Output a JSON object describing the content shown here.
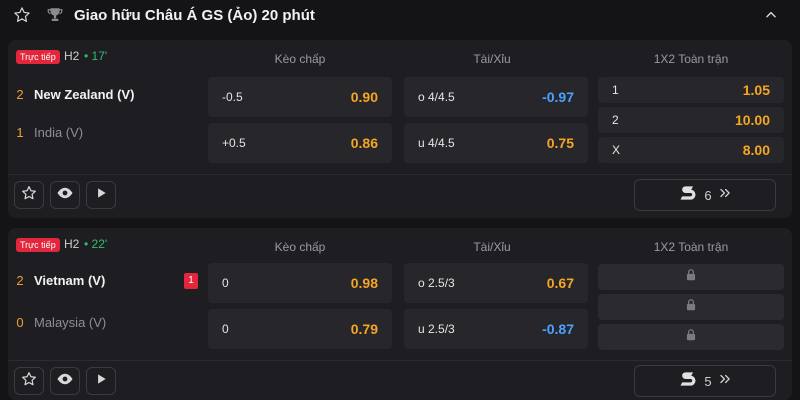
{
  "league": {
    "title": "Giao hữu Châu Á GS (Ảo) 20 phút"
  },
  "columns": {
    "handicap": "Kèo chấp",
    "over_under": "Tài/Xỉu",
    "x12": "1X2 Toàn trận"
  },
  "matches": [
    {
      "live_badge": "Trực tiếp",
      "half": "H2",
      "time": "• 17'",
      "home": {
        "score": "2",
        "name": "New Zealand (V)"
      },
      "away": {
        "score": "1",
        "name": "India (V)"
      },
      "handicap": [
        {
          "line": "-0.5",
          "odds": "0.90"
        },
        {
          "line": "+0.5",
          "odds": "0.86"
        }
      ],
      "over_under": [
        {
          "line": "o 4/4.5",
          "odds": "-0.97"
        },
        {
          "line": "u 4/4.5",
          "odds": "0.75"
        }
      ],
      "x12": [
        {
          "label": "1",
          "odds": "1.05"
        },
        {
          "label": "2",
          "odds": "10.00"
        },
        {
          "label": "X",
          "odds": "8.00"
        }
      ],
      "more_count": "6"
    },
    {
      "live_badge": "Trực tiếp",
      "half": "H2",
      "time": "• 22'",
      "home": {
        "score": "2",
        "name": "Vietnam (V)",
        "red_cards": "1"
      },
      "away": {
        "score": "0",
        "name": "Malaysia (V)"
      },
      "handicap": [
        {
          "line": "0",
          "odds": "0.98"
        },
        {
          "line": "0",
          "odds": "0.79"
        }
      ],
      "over_under": [
        {
          "line": "o 2.5/3",
          "odds": "0.67"
        },
        {
          "line": "u 2.5/3",
          "odds": "-0.87"
        }
      ],
      "x12_locked": true,
      "more_count": "5"
    }
  ],
  "colors": {
    "positive_odds": "#f5a623",
    "negative_odds": "#4aa3ff",
    "live": "#e2263b",
    "minute": "#2fbf71"
  }
}
